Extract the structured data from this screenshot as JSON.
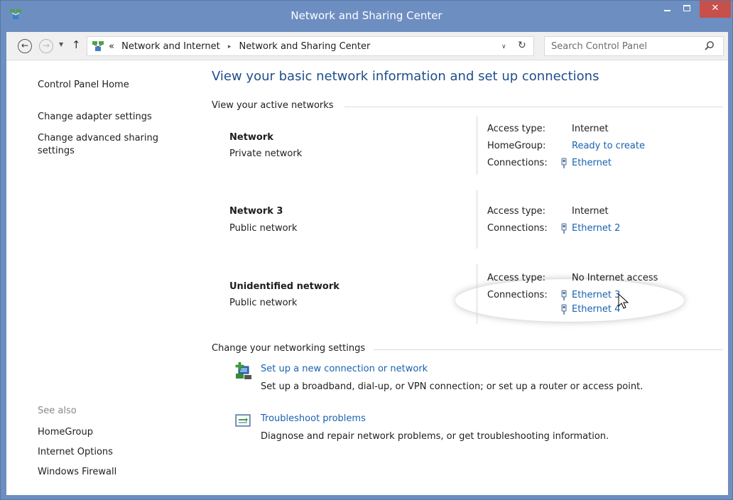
{
  "window": {
    "title": "Network and Sharing Center",
    "close_glyph": "✕",
    "colors": {
      "titlebar": "#6d8ec1",
      "close_button": "#c7504b",
      "link": "#1a62b0",
      "heading": "#1e4e8c"
    }
  },
  "address_bar": {
    "back_glyph": "←",
    "forward_glyph": "→",
    "up_glyph": "↑",
    "overflow": "«",
    "crumbs": [
      "Network and Internet",
      "Network and Sharing Center"
    ],
    "separator": "▸",
    "dropdown_glyph": "∨",
    "refresh_glyph": "↻",
    "search_placeholder": "Search Control Panel"
  },
  "sidebar": {
    "home": "Control Panel Home",
    "links": [
      "Change adapter settings",
      "Change advanced sharing settings"
    ],
    "see_also_label": "See also",
    "see_also": [
      "HomeGroup",
      "Internet Options",
      "Windows Firewall"
    ]
  },
  "main": {
    "title": "View your basic network information and set up connections",
    "active_networks_heading": "View your active networks",
    "networks": [
      {
        "name": "Network",
        "category": "Private network",
        "access_type_label": "Access type:",
        "access_type": "Internet",
        "homegroup_label": "HomeGroup:",
        "homegroup": "Ready to create",
        "connections_label": "Connections:",
        "connections": [
          "Ethernet"
        ]
      },
      {
        "name": "Network  3",
        "category": "Public network",
        "access_type_label": "Access type:",
        "access_type": "Internet",
        "connections_label": "Connections:",
        "connections": [
          "Ethernet 2"
        ]
      },
      {
        "name": "Unidentified network",
        "category": "Public network",
        "access_type_label": "Access type:",
        "access_type": "No Internet access",
        "connections_label": "Connections:",
        "connections": [
          "Ethernet 3",
          "Ethernet 4"
        ]
      }
    ],
    "settings_heading": "Change your networking settings",
    "tasks": [
      {
        "icon": "new-connection-icon",
        "link": "Set up a new connection or network",
        "description": "Set up a broadband, dial-up, or VPN connection; or set up a router or access point."
      },
      {
        "icon": "troubleshoot-icon",
        "link": "Troubleshoot problems",
        "description": "Diagnose and repair network problems, or get troubleshooting information."
      }
    ]
  }
}
